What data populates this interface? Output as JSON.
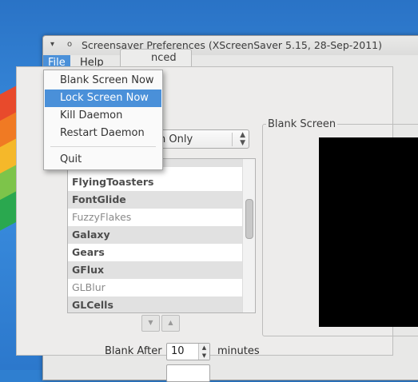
{
  "window": {
    "title": "Screensaver Preferences  (XScreenSaver 5.15, 28-Sep-2011)",
    "close_glyph": "▾",
    "minimize_glyph": "o"
  },
  "menubar": {
    "file": "File",
    "help": "Help"
  },
  "file_menu": {
    "items": [
      "Blank Screen Now",
      "Lock Screen Now",
      "Kill Daemon",
      "Restart Daemon"
    ],
    "highlighted_index": 1,
    "quit": "Quit"
  },
  "tabs": {
    "advanced_partial": "nced"
  },
  "mode": {
    "selected_partial": "n Only",
    "arrow_up": "▲",
    "arrow_down": "▼"
  },
  "screensavers": [
    {
      "name": "FlyingToasters",
      "enabled": true
    },
    {
      "name": "FontGlide",
      "enabled": true
    },
    {
      "name": "FuzzyFlakes",
      "enabled": false
    },
    {
      "name": "Galaxy",
      "enabled": true
    },
    {
      "name": "Gears",
      "enabled": true
    },
    {
      "name": "GFlux",
      "enabled": true
    },
    {
      "name": "GLBlur",
      "enabled": false
    },
    {
      "name": "GLCells",
      "enabled": true
    }
  ],
  "list_nav": {
    "down": "▼",
    "up": "▲"
  },
  "preview": {
    "label": "Blank Screen"
  },
  "blank_after": {
    "label": "Blank After",
    "value": "10",
    "unit": "minutes",
    "up": "▲",
    "down": "▼"
  },
  "colors": {
    "accent": "#4a90d9",
    "window_bg": "#e8e8e7",
    "preview_bg": "#000000"
  }
}
